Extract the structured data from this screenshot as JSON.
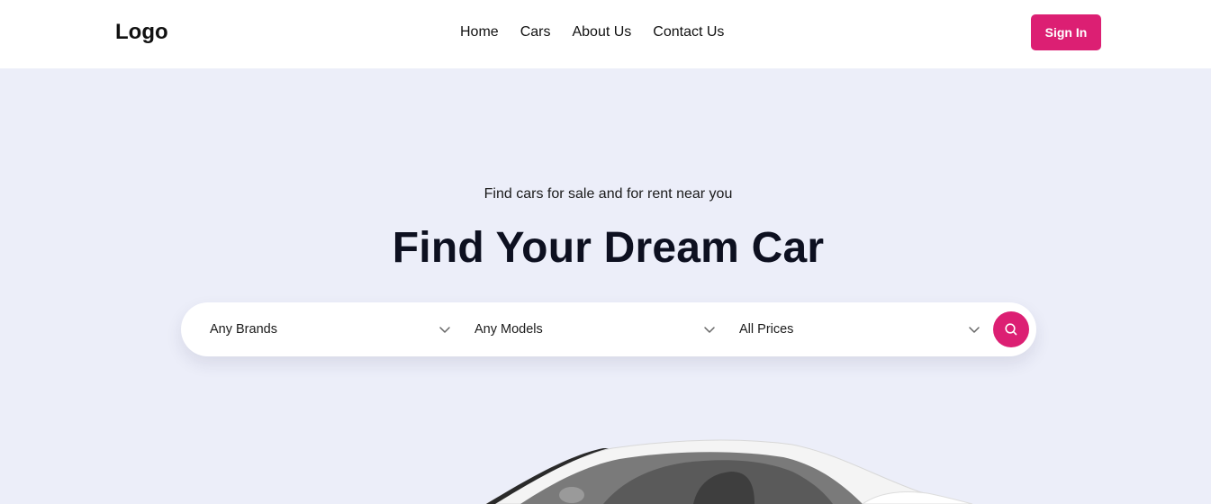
{
  "header": {
    "logo": "Logo",
    "nav": [
      "Home",
      "Cars",
      "About Us",
      "Contact Us"
    ],
    "signin_label": "Sign In"
  },
  "hero": {
    "subtitle": "Find cars for sale and for rent near you",
    "title": "Find Your Dream Car"
  },
  "search": {
    "brand": "Any Brands",
    "model": "Any Models",
    "price": "All Prices",
    "icon": "search-icon"
  },
  "colors": {
    "accent": "#dc1f73",
    "background": "#eceef9"
  }
}
